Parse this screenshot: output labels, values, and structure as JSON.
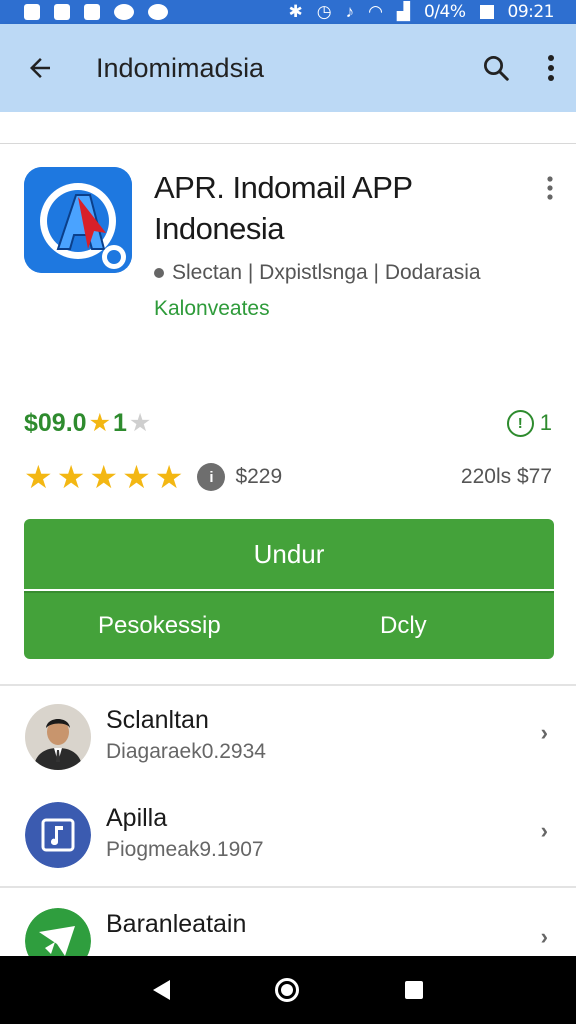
{
  "status_bar": {
    "battery_text": "0/4%",
    "time": "09:21"
  },
  "app_bar": {
    "title": "Indomimadsia",
    "back_icon": "arrow-left-icon",
    "search_icon": "search-icon",
    "more_icon": "more-vert-icon"
  },
  "app": {
    "title": "APR. Indomail APP Indonesia",
    "developer": "Slectan | Dxpistlsnga | Dodarasia",
    "category": "Kalonveates",
    "price": "$09.0",
    "price_rating_digit": "1",
    "info_value": "1",
    "rating_stars": 5,
    "review_count": "$229",
    "downloads": "220ls $77",
    "colors": {
      "accent_green": "#44a23a",
      "star_gold": "#f3b713",
      "app_bar": "#bcd9f5"
    }
  },
  "buttons": {
    "install": "Undur",
    "secondary_left": "Pesokessip",
    "secondary_right": "Dcly"
  },
  "list": [
    {
      "title": "Sclanltan",
      "subtitle": "Diagaraek0.2934",
      "avatar_icon": "person-avatar"
    },
    {
      "title": "Apilla",
      "subtitle": "Piogmeak9.1907",
      "avatar_icon": "music-note-icon"
    },
    {
      "title": "Baranleatain",
      "subtitle": "",
      "avatar_icon": "rocket-icon"
    }
  ]
}
